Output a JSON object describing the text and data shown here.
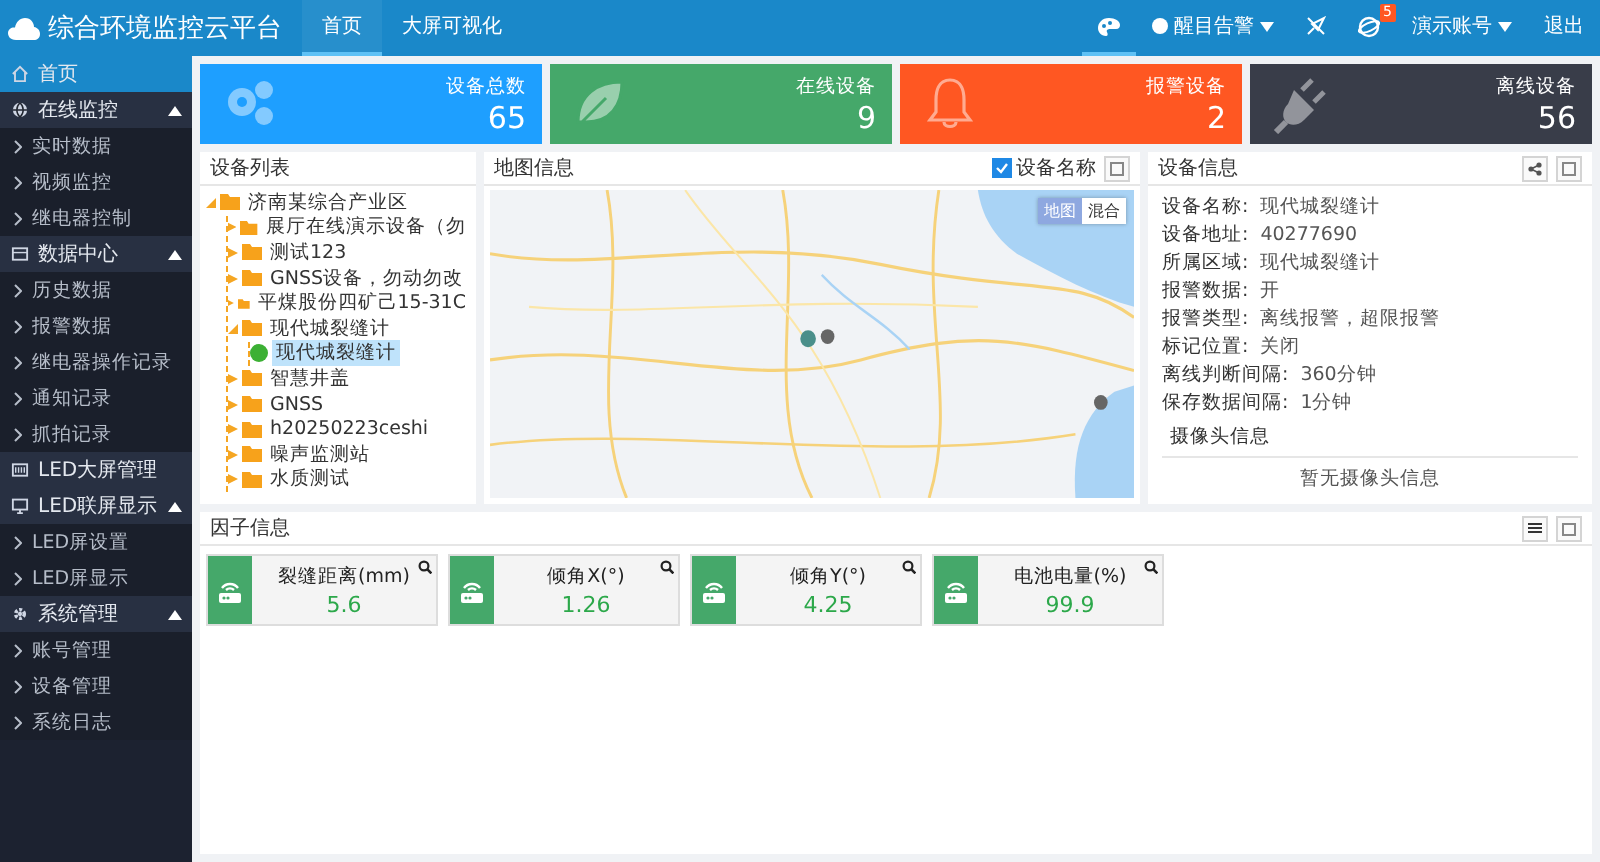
{
  "header": {
    "title": "综合环境监控云平台",
    "nav": [
      {
        "label": "首页",
        "selected": true
      },
      {
        "label": "大屏可视化",
        "selected": false
      }
    ],
    "alarm_mode": "醒目告警",
    "badge": "5",
    "account": "演示账号",
    "logout": "退出"
  },
  "sidebar": {
    "items": [
      {
        "label": "首页",
        "selected": true
      },
      {
        "label": "在线监控",
        "selected": false,
        "expanded": true,
        "children": [
          {
            "label": "实时数据",
            "selected": false
          },
          {
            "label": "视频监控",
            "selected": false
          },
          {
            "label": "继电器控制",
            "selected": false
          }
        ]
      },
      {
        "label": "数据中心",
        "selected": false,
        "expanded": true,
        "children": [
          {
            "label": "历史数据",
            "selected": false
          },
          {
            "label": "报警数据",
            "selected": false
          },
          {
            "label": "继电器操作记录",
            "selected": false
          },
          {
            "label": "通知记录",
            "selected": false
          },
          {
            "label": "抓拍记录",
            "selected": false
          }
        ]
      },
      {
        "label": "LED大屏管理",
        "selected": false
      },
      {
        "label": "LED联屏显示",
        "selected": false,
        "expanded": true,
        "children": [
          {
            "label": "LED屏设置",
            "selected": false
          },
          {
            "label": "LED屏显示",
            "selected": false
          }
        ]
      },
      {
        "label": "系统管理",
        "selected": false,
        "expanded": true,
        "children": [
          {
            "label": "账号管理",
            "selected": false
          },
          {
            "label": "设备管理",
            "selected": false
          },
          {
            "label": "系统日志",
            "selected": false
          }
        ]
      }
    ]
  },
  "stats": [
    {
      "label": "设备总数",
      "value": "65",
      "color": "#1e9fff"
    },
    {
      "label": "在线设备",
      "value": "9",
      "color": "#45a86a"
    },
    {
      "label": "报警设备",
      "value": "2",
      "color": "#ff5722"
    },
    {
      "label": "离线设备",
      "value": "56",
      "color": "#393d49"
    }
  ],
  "tree": {
    "title": "设备列表",
    "items": [
      {
        "label": "济南某综合产业区",
        "kind": "folder",
        "expanded": true,
        "children": [
          {
            "label": "展厅在线演示设备（勿",
            "kind": "folder",
            "expanded": false
          },
          {
            "label": "测试123",
            "kind": "folder",
            "expanded": false
          },
          {
            "label": "GNSS设备，勿动勿改",
            "kind": "folder",
            "expanded": false
          },
          {
            "label": "平煤股份四矿己15-31C",
            "kind": "folder",
            "expanded": false
          },
          {
            "label": "现代城裂缝计",
            "kind": "folder",
            "expanded": true,
            "children": [
              {
                "label": "现代城裂缝计",
                "kind": "device",
                "selected": true,
                "color": "#3cb034"
              }
            ]
          },
          {
            "label": "智慧井盖",
            "kind": "folder",
            "expanded": false
          },
          {
            "label": "GNSS",
            "kind": "folder",
            "expanded": false
          },
          {
            "label": "h20250223ceshi",
            "kind": "folder",
            "expanded": false
          },
          {
            "label": "噪声监测站",
            "kind": "folder",
            "expanded": false
          },
          {
            "label": "水质测试",
            "kind": "folder",
            "expanded": false
          }
        ]
      }
    ]
  },
  "map": {
    "title": "地图信息",
    "show_names": {
      "label": "设备名称",
      "checked": true
    },
    "types": [
      {
        "label": "地图",
        "selected": true
      },
      {
        "label": "混合",
        "selected": false
      }
    ]
  },
  "info": {
    "title": "设备信息",
    "fields": [
      {
        "label": "设备名称:",
        "value": "现代城裂缝计"
      },
      {
        "label": "设备地址:",
        "value": "40277690"
      },
      {
        "label": "所属区域:",
        "value": "现代城裂缝计"
      },
      {
        "label": "报警数据:",
        "value": "开"
      },
      {
        "label": "报警类型:",
        "value": "离线报警，超限报警"
      },
      {
        "label": "标记位置:",
        "value": "关闭"
      },
      {
        "label": "离线判断间隔:",
        "value": "360分钟"
      },
      {
        "label": "保存数据间隔:",
        "value": "1分钟"
      }
    ],
    "camera_title": "摄像头信息",
    "camera_empty": "暂无摄像头信息"
  },
  "factors": {
    "title": "因子信息",
    "items": [
      {
        "name": "裂缝距离(mm)",
        "value": "5.6"
      },
      {
        "name": "倾角X(°)",
        "value": "1.26"
      },
      {
        "name": "倾角Y(°)",
        "value": "4.25"
      },
      {
        "name": "电池电量(%)",
        "value": "99.9"
      }
    ]
  }
}
